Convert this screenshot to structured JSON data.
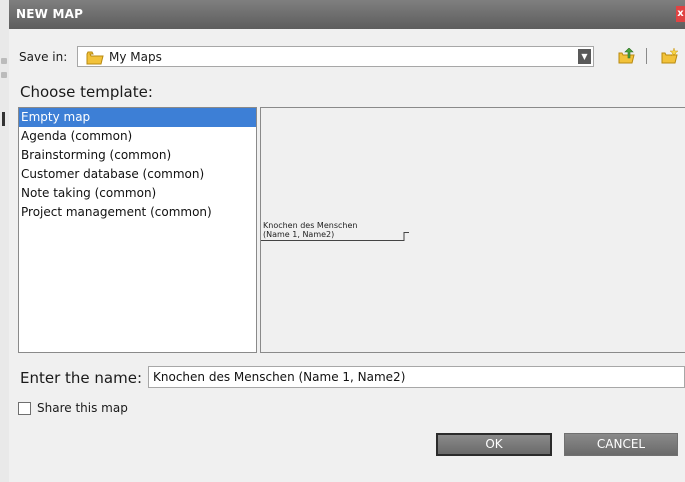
{
  "window": {
    "title": "NEW MAP",
    "close_label": "x"
  },
  "save_in": {
    "label": "Save in:",
    "value": "My Maps"
  },
  "toolbar": {
    "up_folder_icon": "folder-up-icon",
    "new_folder_icon": "new-folder-icon"
  },
  "templates": {
    "heading": "Choose template:",
    "items": [
      {
        "label": "Empty map",
        "selected": true
      },
      {
        "label": "Agenda (common)",
        "selected": false
      },
      {
        "label": "Brainstorming (common)",
        "selected": false
      },
      {
        "label": "Customer database (common)",
        "selected": false
      },
      {
        "label": "Note taking (common)",
        "selected": false
      },
      {
        "label": "Project management (common)",
        "selected": false
      }
    ]
  },
  "preview": {
    "node_line1": "Knochen des Menschen",
    "node_line2": "(Name 1, Name2)"
  },
  "name": {
    "label": "Enter the name:",
    "value": "Knochen des Menschen (Name 1, Name2)"
  },
  "share": {
    "label": "Share this map",
    "checked": false
  },
  "buttons": {
    "ok": "OK",
    "cancel": "CANCEL"
  },
  "colors": {
    "accent_selection": "#3d7fd6",
    "titlebar": "#6e6e6e",
    "folder_yellow": "#f2c23a",
    "close_red": "#e04343"
  }
}
